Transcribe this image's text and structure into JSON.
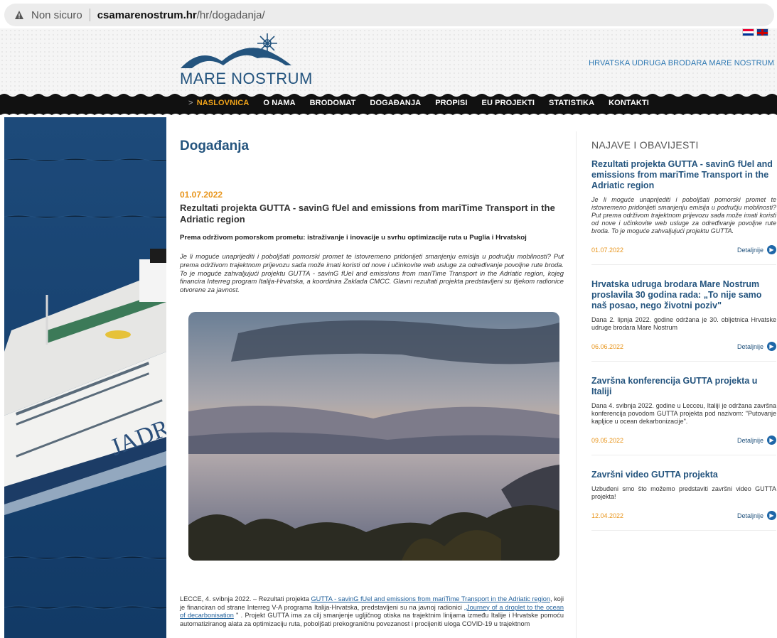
{
  "browser": {
    "security_label": "Non sicuro",
    "domain": "csamarenostrum.hr",
    "path": "/hr/dogadanja/"
  },
  "header": {
    "logo_text": "MARE NOSTRUM",
    "tagline": "HRVATSKA UDRUGA BRODARA MARE NOSTRUM"
  },
  "nav": {
    "items": [
      {
        "label": "NASLOVNICA"
      },
      {
        "label": "O NAMA"
      },
      {
        "label": "BRODOMAT"
      },
      {
        "label": "DOGAĐANJA"
      },
      {
        "label": "PROPISI"
      },
      {
        "label": "EU PROJEKTI"
      },
      {
        "label": "STATISTIKA"
      },
      {
        "label": "KONTAKTI"
      }
    ]
  },
  "main": {
    "page_title": "Događanja",
    "date": "01.07.2022",
    "article_title": "Rezultati projekta GUTTA - savinG fUel and emissions from mariTime Transport in the Adriatic region",
    "subtitle": "Prema održivom pomorskom prometu: istraživanje i inovacije u svrhu optimizacije ruta u Puglia i Hrvatskoj",
    "lead": "Je li moguće unaprijediti i poboljšati pomorski promet te istovremeno pridonijeti smanjenju emisija u području mobilnosti? Put prema održivom trajektnom prijevozu sada može imati koristi od nove i učinkovite web usluge za određivanje povoljne rute broda. To je moguće zahvaljujući projektu GUTTA - savinG fUel and emissions from mariTime Transport in the Adriatic region, kojeg financira Interreg program Italija-Hrvatska, a koordinira Zaklada CMCC. Glavni rezultati projekta predstavljeni su tijekom radionice otvorene za javnost.",
    "body_prefix": "LECCE, 4. svibnja 2022. – Rezultati projekta ",
    "body_link1": "GUTTA - savinG fUel and emissions from mariTime Transport in the Adriatic region",
    "body_mid": ", koji je financiran od strane Interreg V-A programa Italija-Hrvatska, predstavljeni su na javnoj radionici ",
    "body_link2": "„Journey of a droplet to the ocean of decarbonisation",
    "body_suffix": " \" . Projekt GUTTA ima za cilj smanjenje ugljičnog otiska na trajektnim linijama između Italije i Hrvatske pomoću automatiziranog alata za optimizaciju ruta, poboljšati prekograničnu povezanost i procijeniti uloga COVID-19 u trajektnom"
  },
  "sidebar": {
    "title": "NAJAVE I OBAVIJESTI",
    "more_label": "Detaljnije",
    "news": [
      {
        "title": "Rezultati projekta GUTTA - savinG fUel and emissions from mariTime Transport in the Adriatic region",
        "text": "Je li moguće unaprijediti i poboljšati pomorski promet te istovremeno pridonijeti smanjenju emisija u području mobilnosti? Put prema održivom trajektnom prijevozu sada može imati koristi od nove i učinkovite web usluge za određivanje povoljne rute broda. To je moguće zahvaljujući projektu GUTTA.",
        "date": "01.07.2022"
      },
      {
        "title": "Hrvatska udruga brodara Mare Nostrum proslavila 30 godina rada: „To nije samo naš posao, nego životni poziv\"",
        "text": "Dana 2. lipnja 2022. godine održana je 30. obljetnica Hrvatske udruge brodara Mare Nostrum",
        "date": "06.06.2022"
      },
      {
        "title": "Završna konferencija GUTTA projekta u Italiji",
        "text": "Dana 4. svibnja 2022. godine u Lecceu, Italiji je održana završna konferencija povodom GUTTA projekta pod nazivom: \"Putovanje kapljice u ocean dekarbonizacije\".",
        "date": "09.05.2022"
      },
      {
        "title": "Završni video GUTTA projekta",
        "text": "Uzbuđeni smo što možemo predstaviti završni video GUTTA projekta!",
        "date": "12.04.2022"
      }
    ]
  }
}
